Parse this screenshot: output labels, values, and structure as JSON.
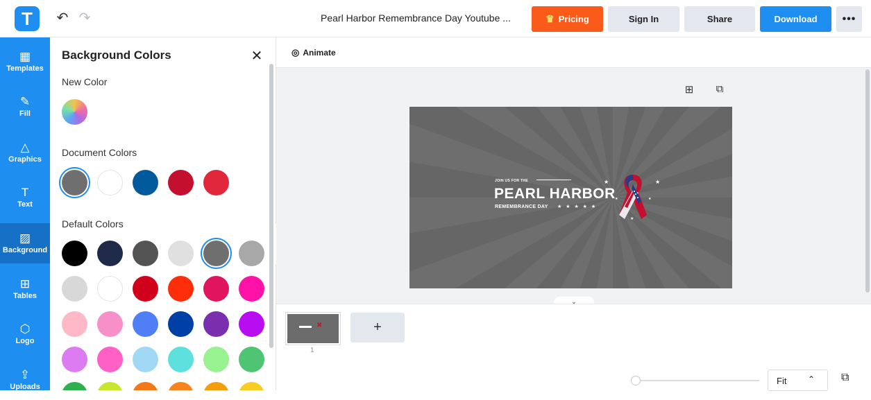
{
  "header": {
    "logo_letter": "T",
    "doc_title": "Pearl Harbor Remembrance Day Youtube ...",
    "pricing_label": "Pricing",
    "signin_label": "Sign In",
    "share_label": "Share",
    "download_label": "Download",
    "more_label": "•••",
    "undo_icon": "↶",
    "redo_icon": "↷"
  },
  "sidebar": {
    "items": [
      {
        "label": "Templates",
        "icon": "▦"
      },
      {
        "label": "Fill",
        "icon": "✎"
      },
      {
        "label": "Graphics",
        "icon": "△"
      },
      {
        "label": "Text",
        "icon": "T"
      },
      {
        "label": "Background",
        "icon": "▨"
      },
      {
        "label": "Tables",
        "icon": "⊞"
      },
      {
        "label": "Logo",
        "icon": "⬡"
      },
      {
        "label": "Uploads",
        "icon": "⇪"
      }
    ],
    "active": "Background"
  },
  "panel": {
    "title": "Background Colors",
    "close_icon": "✕",
    "new_color_label": "New Color",
    "document_colors_label": "Document Colors",
    "default_colors_label": "Default Colors",
    "document_colors": [
      "#6f6f6f",
      "#ffffff",
      "#005a9c",
      "#c2102e",
      "#e0273b"
    ],
    "default_colors": [
      "#000000",
      "#1e2a47",
      "#545454",
      "#e0e0e0",
      "#6f6f6f",
      "#a8a8a8",
      "#d8d8d8",
      "#ffffff",
      "#d0021b",
      "#ff2e0a",
      "#e0155e",
      "#ff12a8",
      "#ffb8c8",
      "#f78fc9",
      "#4f7ef7",
      "#003fa5",
      "#7a2fae",
      "#b80df0",
      "#dd7bf0",
      "#ff60c5",
      "#a0d8f6",
      "#5ee0de",
      "#98f28f",
      "#4fc574",
      "#2fb04f",
      "#c7e62f",
      "#f37817",
      "#f7841f",
      "#f59e0b",
      "#f7cc26"
    ]
  },
  "workspace": {
    "animate_label": "Animate",
    "animate_icon": "◎",
    "add_icon": "⊞",
    "copy_icon": "⧉",
    "canvas": {
      "join_text": "JOIN US FOR THE",
      "main_text": "PEARL HARBOR",
      "sub_text": "REMEMBRANCE DAY",
      "stars_text": "★ ★ ★ ★ ★"
    },
    "expand_icon": "⌄",
    "collapse_icon": "‹"
  },
  "pages": {
    "page_number": "1",
    "add_page_label": "+"
  },
  "zoom": {
    "value": "Fit",
    "chevron": "⌃",
    "pages_icon": "⧉"
  }
}
